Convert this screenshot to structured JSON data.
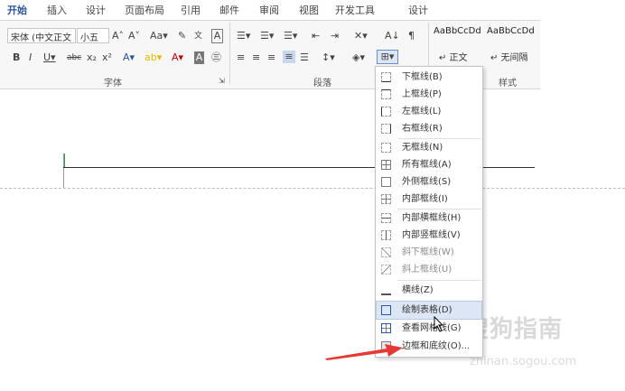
{
  "tabs": [
    "开始",
    "插入",
    "设计",
    "页面布局",
    "引用",
    "邮件",
    "审阅",
    "视图",
    "开发工具",
    "设计"
  ],
  "font": {
    "name": "宋体 (中文正文",
    "size": "小五",
    "group_label": "字体"
  },
  "paragraph": {
    "group_label": "段落"
  },
  "styles": {
    "group_label": "样式",
    "items": [
      {
        "preview": "AaBbCcDd",
        "name": "↵ 正文"
      },
      {
        "preview": "AaBbCcDd",
        "name": "↵ 无间隔"
      }
    ]
  },
  "border_menu": {
    "items": [
      {
        "label": "下框线(B)"
      },
      {
        "label": "上框线(P)"
      },
      {
        "label": "左框线(L)"
      },
      {
        "label": "右框线(R)"
      },
      {
        "label": "无框线(N)"
      },
      {
        "label": "所有框线(A)"
      },
      {
        "label": "外侧框线(S)"
      },
      {
        "label": "内部框线(I)"
      },
      {
        "label": "内部横框线(H)"
      },
      {
        "label": "内部竖框线(V)"
      },
      {
        "label": "斜下框线(W)"
      },
      {
        "label": "斜上框线(U)"
      },
      {
        "label": "横线(Z)"
      },
      {
        "label": "绘制表格(D)"
      },
      {
        "label": "查看网格线(G)"
      },
      {
        "label": "边框和底纹(O)..."
      }
    ]
  },
  "watermark": {
    "text": "搜狗指南",
    "url": "zhinan.sogou.com"
  },
  "colors": {
    "accent": "#2b579a",
    "highlight": "#dce6f4",
    "arrow": "#e53935"
  }
}
